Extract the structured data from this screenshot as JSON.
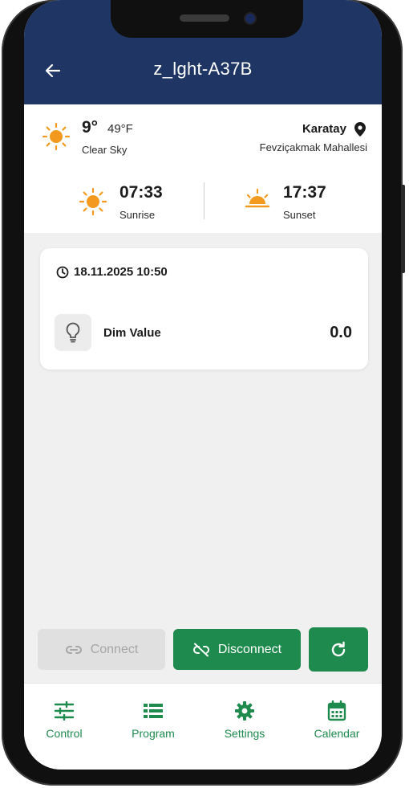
{
  "app": {
    "title": "z_lght-A37B"
  },
  "weather": {
    "temp_c": "9°",
    "temp_f": "49°F",
    "condition": "Clear Sky",
    "city": "Karatay",
    "district": "Fevziçakmak Mahallesi",
    "sunrise_time": "07:33",
    "sunrise_label": "Sunrise",
    "sunset_time": "17:37",
    "sunset_label": "Sunset",
    "icons": {
      "condition": "sun-icon",
      "sunrise": "sunrise-icon",
      "sunset": "sunset-icon",
      "location": "location-pin-icon"
    }
  },
  "card": {
    "datetime": "18.11.2025 10:50",
    "dim_label": "Dim Value",
    "dim_value": "0.0",
    "icons": {
      "time": "clock-icon",
      "light": "lightbulb-icon"
    }
  },
  "actions": {
    "connect_label": "Connect",
    "connect_enabled": false,
    "disconnect_label": "Disconnect",
    "refresh_icon": "refresh-icon"
  },
  "nav": {
    "items": [
      {
        "label": "Control",
        "icon": "sliders-icon"
      },
      {
        "label": "Program",
        "icon": "list-icon"
      },
      {
        "label": "Settings",
        "icon": "gear-icon"
      },
      {
        "label": "Calendar",
        "icon": "calendar-icon"
      }
    ]
  },
  "colors": {
    "appbar": "#1f3564",
    "primary_green": "#1e8a4d",
    "sun_orange": "#f39a1e",
    "disabled_bg": "#e0e0e0",
    "disabled_text": "#a6a6a6"
  }
}
